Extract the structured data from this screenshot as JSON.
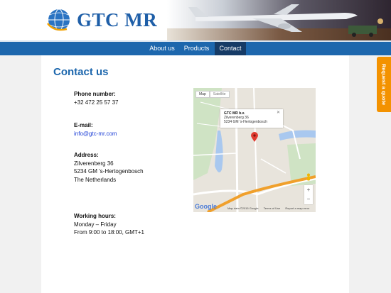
{
  "brand": {
    "name": "GTC MR"
  },
  "nav": {
    "items": [
      {
        "label": "About us"
      },
      {
        "label": "Products"
      },
      {
        "label": "Contact"
      }
    ]
  },
  "page": {
    "title": "Contact us"
  },
  "contact": {
    "phone_label": "Phone number:",
    "phone": "+32 472 25 57 37",
    "email_label": "E-mail:",
    "email": "info@gtc-mr.com",
    "address_label": "Address:",
    "address_line1": "Zilverenberg 36",
    "address_line2": "5234 GM 's-Hertogenbosch",
    "address_line3": "The Netherlands",
    "hours_label": "Working hours:",
    "hours_line1": "Monday – Friday",
    "hours_line2": "From 9:00 to 18:00, GMT+1"
  },
  "map": {
    "tab_map": "Map",
    "tab_satellite": "Satellite",
    "info_title": "GTC MR b.v.",
    "info_line1": "Zilverenberg 36",
    "info_line2": "5234 GM 's-Hertogenbosch",
    "zoom_in": "+",
    "zoom_out": "−",
    "google": "Google",
    "footer_data": "Map data ©2015 Google",
    "footer_terms": "Terms of Use",
    "footer_report": "Report a map error",
    "close": "✕"
  },
  "quote_tab": {
    "label": "Request a quote"
  },
  "colors": {
    "primary": "#1d67ad",
    "nav_active": "#163b66",
    "accent": "#f39200"
  }
}
